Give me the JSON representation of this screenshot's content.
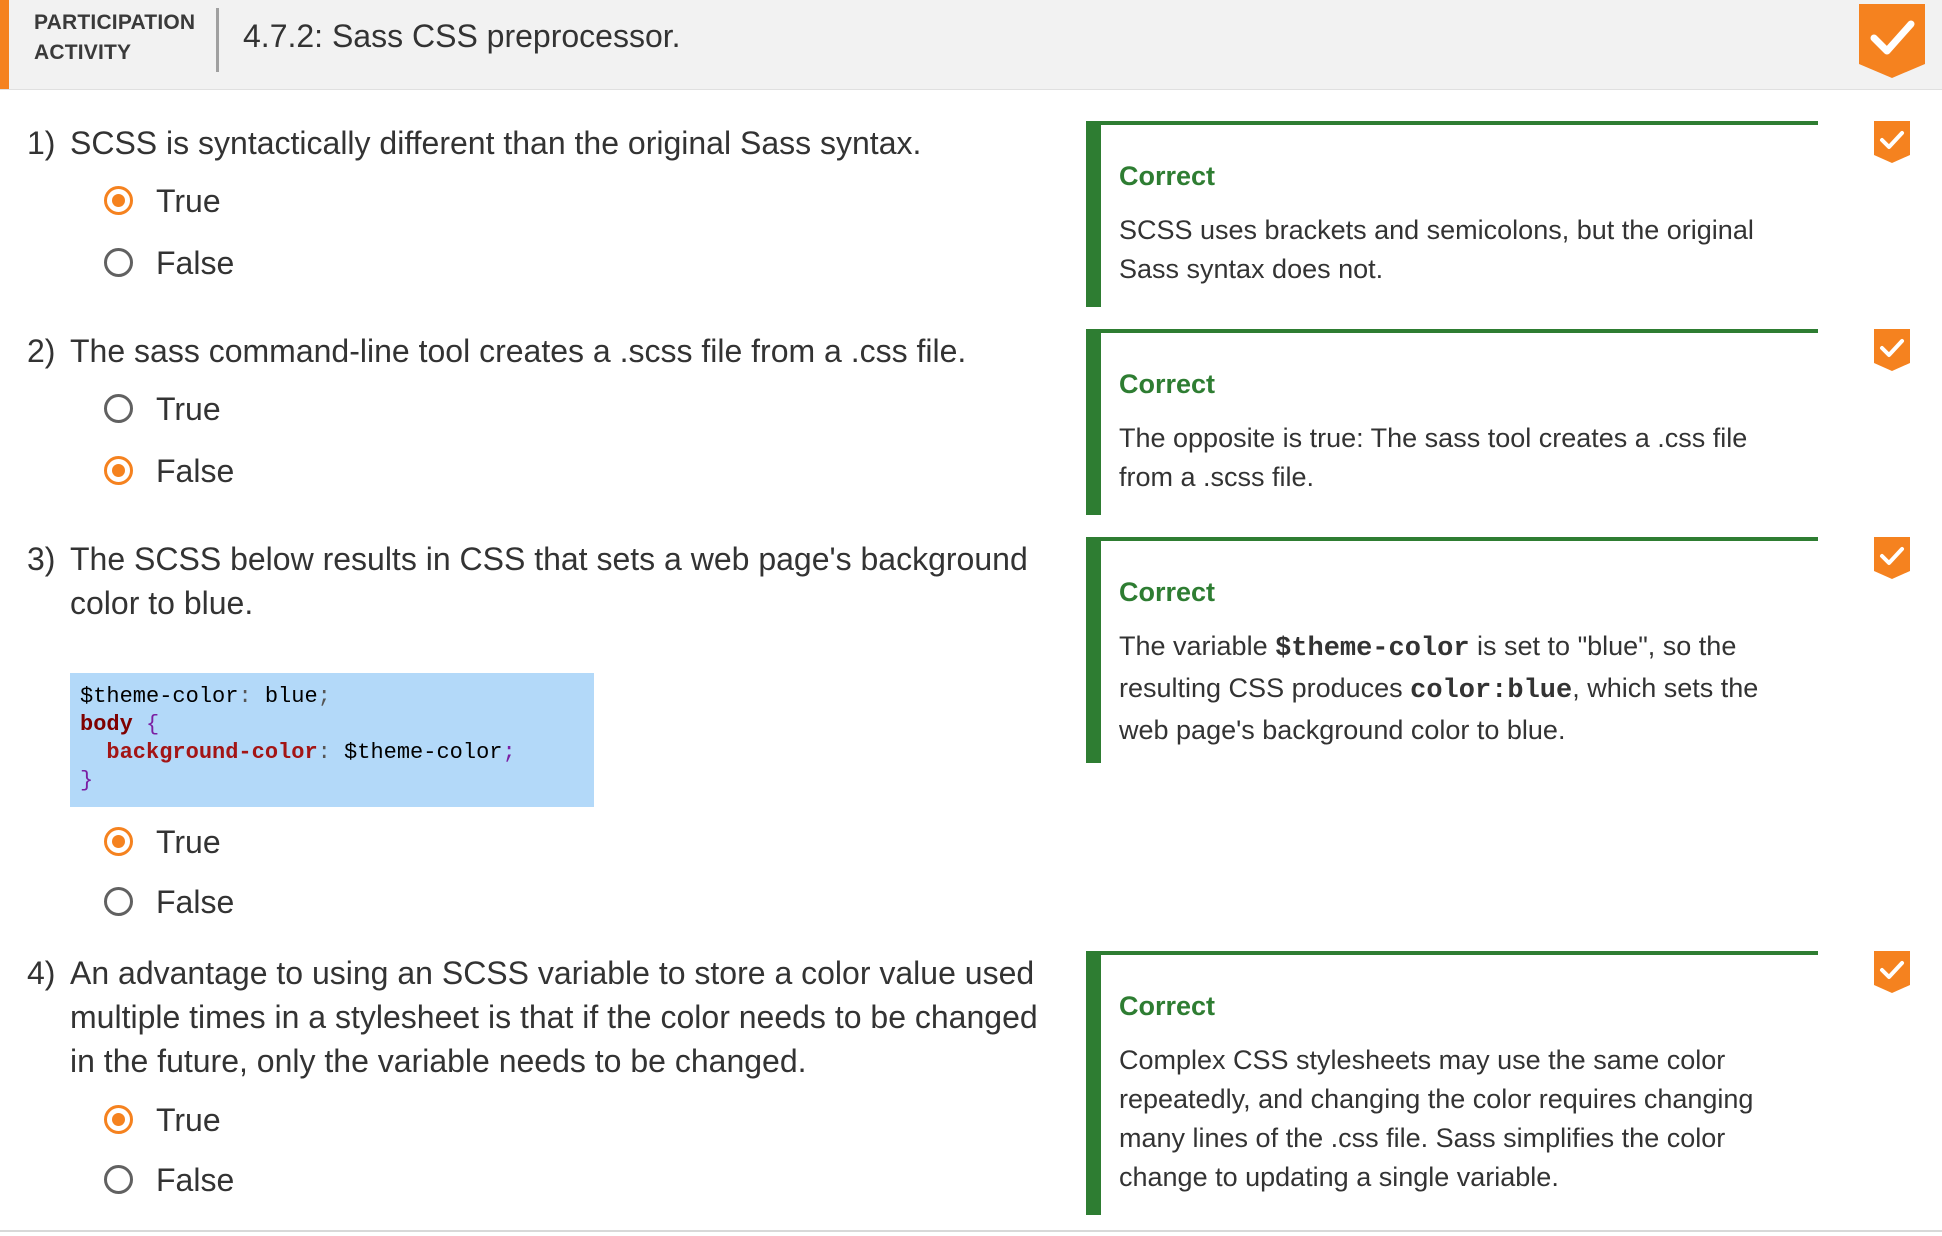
{
  "header": {
    "activity_label_line1": "PARTICIPATION",
    "activity_label_line2": "ACTIVITY",
    "title": "4.7.2: Sass CSS preprocessor.",
    "accent_color": "#f5821f",
    "completion_icon": "checkmark-badge-icon"
  },
  "questions": [
    {
      "number": "1)",
      "text": "SCSS is syntactically different than the original Sass syntax.",
      "choices": [
        {
          "label": "True",
          "selected": true
        },
        {
          "label": "False",
          "selected": false
        }
      ],
      "feedback": {
        "title": "Correct",
        "text": "SCSS uses brackets and semicolons, but the original Sass syntax does not."
      }
    },
    {
      "number": "2)",
      "text": "The sass command-line tool creates a .scss file from a .css file.",
      "choices": [
        {
          "label": "True",
          "selected": false
        },
        {
          "label": "False",
          "selected": true
        }
      ],
      "feedback": {
        "title": "Correct",
        "text": "The opposite is true: The sass tool creates a .css file from a .scss file."
      }
    },
    {
      "number": "3)",
      "text": "The SCSS below results in CSS that sets a web page's background color to blue.",
      "code": {
        "line1_var": "$theme-color",
        "line1_colon": ":",
        "line1_value": " blue",
        "line1_semi": ";",
        "line2_selector": "body",
        "line2_brace": " {",
        "line3_indent": "  ",
        "line3_prop": "background-color",
        "line3_colon": ":",
        "line3_value": " $theme-color",
        "line3_semi": ";",
        "line4_brace": "}"
      },
      "choices": [
        {
          "label": "True",
          "selected": true
        },
        {
          "label": "False",
          "selected": false
        }
      ],
      "feedback": {
        "title": "Correct",
        "text_part1": "The variable ",
        "code1": "$theme-color",
        "text_part2": " is set to \"blue\", so the resulting CSS produces ",
        "code2": "color:blue",
        "text_part3": ", which sets the web page's background color to blue."
      }
    },
    {
      "number": "4)",
      "text": "An advantage to using an SCSS variable to store a color value used multiple times in a stylesheet is that if the color needs to be changed in the future, only the variable needs to be changed.",
      "choices": [
        {
          "label": "True",
          "selected": true
        },
        {
          "label": "False",
          "selected": false
        }
      ],
      "feedback": {
        "title": "Correct",
        "text": "Complex CSS stylesheets may use the same color repeatedly, and changing the color requires changing many lines of the .css file. Sass simplifies the color change to updating a single variable."
      }
    }
  ],
  "colors": {
    "correct_green": "#2e7d32",
    "selected_orange": "#f5821f",
    "code_background": "#b3d9f9"
  }
}
